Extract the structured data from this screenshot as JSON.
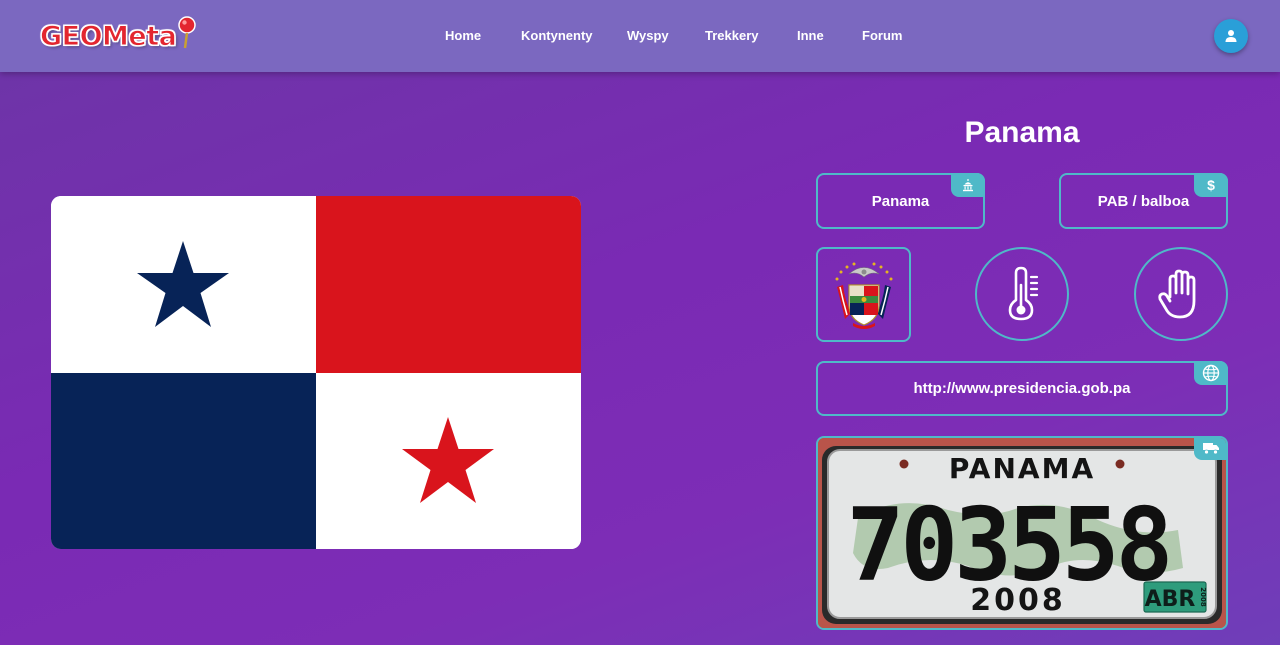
{
  "header": {
    "logo_text": "GEOMeta",
    "nav": [
      {
        "label": "Home"
      },
      {
        "label": "Kontynenty"
      },
      {
        "label": "Wyspy"
      },
      {
        "label": "Trekkery"
      },
      {
        "label": "Inne"
      },
      {
        "label": "Forum"
      }
    ],
    "user_icon": "user-icon"
  },
  "country": {
    "name": "Panama",
    "capital": "Panama",
    "capital_icon": "capitol-building-icon",
    "currency": "PAB / balboa",
    "currency_symbol": "$",
    "website": "http://www.presidencia.gob.pa",
    "website_icon": "globe-icon",
    "plate": {
      "country_text": "PANAMA",
      "number": "703558",
      "year": "2008",
      "sticker_month": "ABR",
      "sticker_year": "2008",
      "icon": "truck-icon"
    },
    "climate_icon": "thermometer-icon",
    "driving_icon": "hand-icon",
    "coat_of_arms": "coat-of-arms-image"
  },
  "colors": {
    "accent": "#4fb9c8",
    "nav_bg": "#7b68c0",
    "flag_red": "#d9141c",
    "flag_blue": "#072357",
    "user_button": "#2a9fd8"
  }
}
